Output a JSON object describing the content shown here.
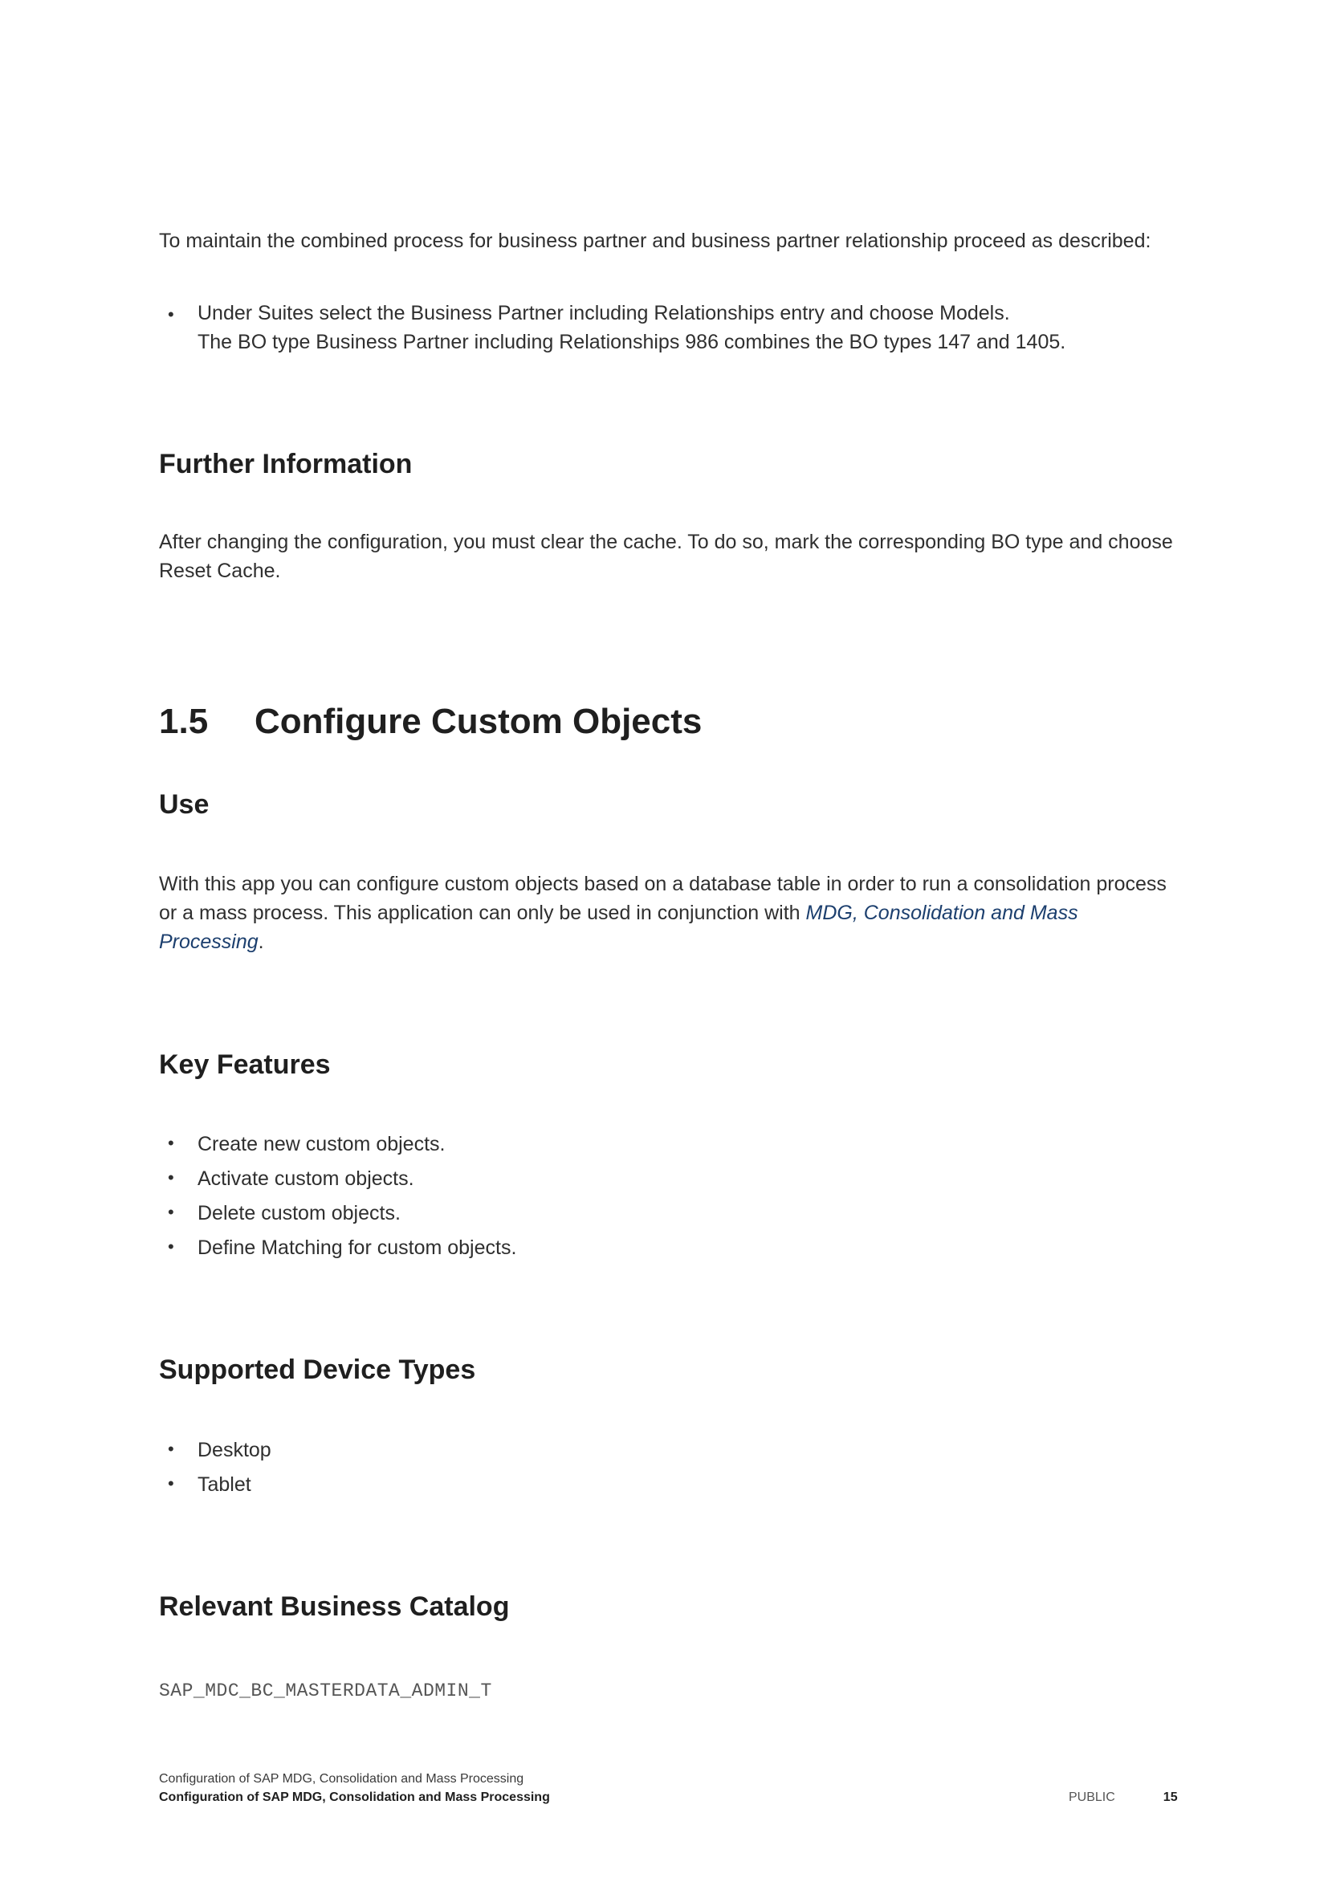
{
  "intro": {
    "paragraph": "To maintain the combined process for business partner and business partner relationship proceed as described:",
    "bullets": [
      {
        "line1": "Under Suites select the Business Partner including Relationships entry and choose Models.",
        "line2": "The BO type Business Partner including Relationships 986 combines the BO types 147 and 1405."
      }
    ]
  },
  "further_information": {
    "heading": "Further Information",
    "paragraph": "After changing the configuration, you must clear the cache. To do so, mark the corresponding BO type and choose Reset Cache."
  },
  "section": {
    "number": "1.5",
    "title": "Configure Custom Objects"
  },
  "use": {
    "heading": "Use",
    "paragraph_start": "With this app you can configure custom objects based on a database table in order to run a consolidation process or a mass process. This application can only be used in conjunction with ",
    "link_text": "MDG, Consolidation and Mass Processing",
    "paragraph_end": "."
  },
  "key_features": {
    "heading": "Key Features",
    "items": [
      "Create new custom objects.",
      "Activate custom objects.",
      "Delete custom objects.",
      "Define Matching for custom objects."
    ]
  },
  "supported_device_types": {
    "heading": "Supported Device Types",
    "items": [
      "Desktop",
      "Tablet"
    ]
  },
  "relevant_business_catalog": {
    "heading": "Relevant Business Catalog",
    "catalog": "SAP_MDC_BC_MASTERDATA_ADMIN_T"
  },
  "footer": {
    "line1": "Configuration of SAP MDG, Consolidation and Mass Processing",
    "line2": "Configuration of SAP MDG, Consolidation and Mass Processing",
    "classification": "PUBLIC",
    "page_number": "15"
  },
  "colors": {
    "text": "#2f2f2f",
    "heading": "#1f1f1f",
    "link": "#1c3f6e",
    "mono": "#555555"
  }
}
